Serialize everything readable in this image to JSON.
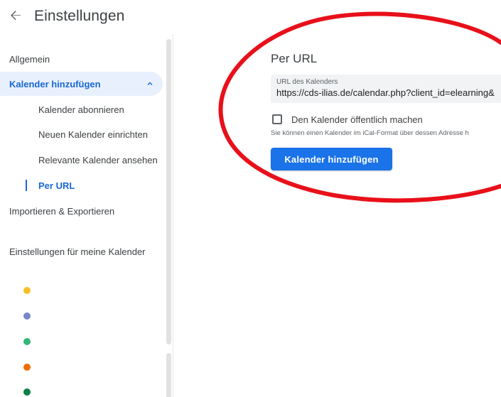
{
  "header": {
    "back_icon": "arrow-back-icon",
    "title": "Einstellungen"
  },
  "sidebar": {
    "items": [
      {
        "label": "Allgemein"
      },
      {
        "label": "Kalender hinzufügen",
        "expanded": true,
        "icon": "chevron-up-icon"
      },
      {
        "label": "Kalender abonnieren"
      },
      {
        "label": "Neuen Kalender einrichten"
      },
      {
        "label": "Relevante Kalender ansehen"
      },
      {
        "label": "Per URL",
        "selected": true
      },
      {
        "label": "Importieren & Exportieren"
      }
    ],
    "my_calendars_heading": "Einstellungen für meine Kalender",
    "calendar_colors": [
      "#f6bf26",
      "#7986cb",
      "#33b679",
      "#ef6c00",
      "#0b8043"
    ]
  },
  "main": {
    "section_title": "Per URL",
    "url_field": {
      "label": "URL des Kalenders",
      "value": "https://cds-ilias.de/calendar.php?client_id=elearning&"
    },
    "public_checkbox": {
      "label": "Den Kalender öffentlich machen",
      "checked": false
    },
    "help_text": "Sie können einen Kalender im iCal-Format über dessen Adresse h",
    "add_button_label": "Kalender hinzufügen"
  },
  "colors": {
    "accent": "#1a73e8",
    "active_text": "#1967d2",
    "active_bg": "#e8f0fe",
    "annotation": "#e8101a"
  }
}
